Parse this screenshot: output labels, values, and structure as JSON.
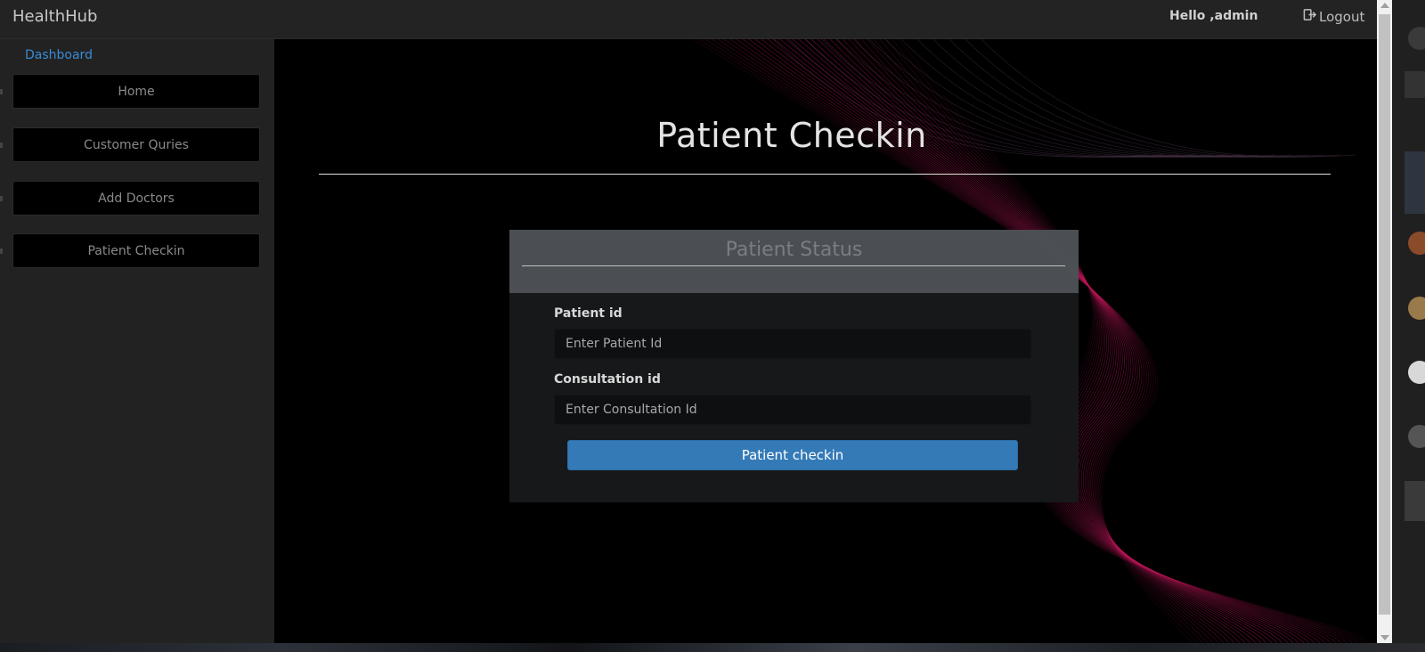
{
  "navbar": {
    "brand": "HealthHub",
    "greeting": "Hello ,admin",
    "logout_label": "Logout",
    "logout_icon": "logout-icon"
  },
  "sidebar": {
    "dashboard_label": "Dashboard",
    "items": [
      {
        "label": "Home"
      },
      {
        "label": "Customer Quries"
      },
      {
        "label": "Add Doctors"
      },
      {
        "label": "Patient Checkin"
      }
    ]
  },
  "main": {
    "title": "Patient Checkin",
    "card": {
      "title": "Patient Status",
      "patient_label": "Patient id",
      "patient_placeholder": "Enter Patient Id",
      "consultation_label": "Consultation id",
      "consultation_placeholder": "Enter Consultation Id",
      "submit_label": "Patient checkin"
    }
  },
  "colors": {
    "accent": "#337ab7",
    "link": "#3a8bd6",
    "wave": "#c2185b"
  }
}
